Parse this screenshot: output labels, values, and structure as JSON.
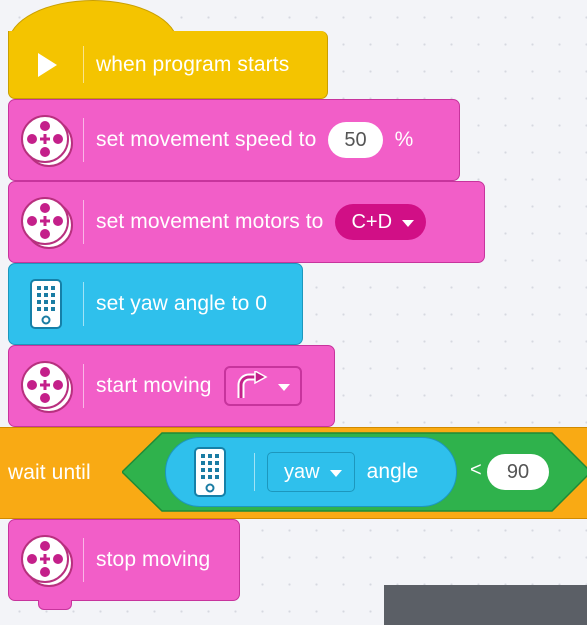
{
  "blocks": {
    "hat": {
      "label": "when program starts"
    },
    "speed": {
      "label": "set movement speed to",
      "value": "50",
      "unit": "%"
    },
    "motors": {
      "label": "set movement motors to",
      "selected": "C+D"
    },
    "yaw_reset": {
      "label": "set yaw angle to 0"
    },
    "start": {
      "label": "start moving"
    },
    "wait": {
      "label": "wait until",
      "sensor_option": "yaw",
      "sensor_label": "angle",
      "operator": "<",
      "value": "90"
    },
    "stop": {
      "label": "stop moving"
    }
  },
  "colors": {
    "events": "#f4c400",
    "movement": "#f25ec8",
    "hub_sensor": "#2fc0ec",
    "control": "#f9aa14",
    "operator": "#2fb24c",
    "dropdown_dark": "#d10f86"
  },
  "icons": {
    "hat": "play-icon",
    "movement": "motor-wheel-icon",
    "hub": "hub-icon",
    "direction": "turn-right-icon"
  }
}
